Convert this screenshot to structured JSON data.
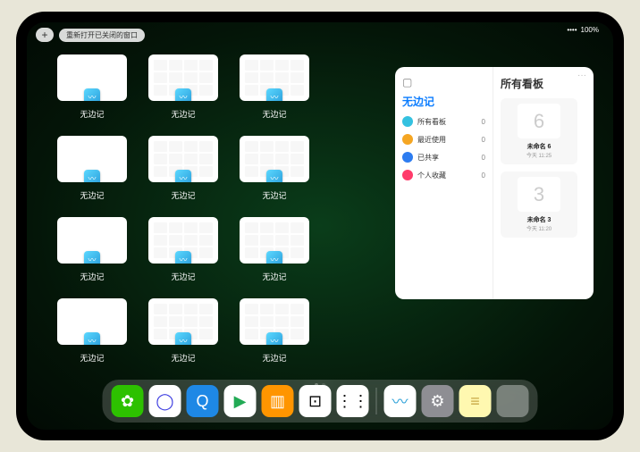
{
  "status": {
    "battery": "100%",
    "signal": "••••"
  },
  "top": {
    "plus": "+",
    "reopen": "重新打开已关闭的窗口"
  },
  "windows": [
    {
      "label": "无边记",
      "style": "blank"
    },
    {
      "label": "无边记",
      "style": "grid"
    },
    {
      "label": "无边记",
      "style": "grid"
    },
    {
      "label": "无边记",
      "style": "blank"
    },
    {
      "label": "无边记",
      "style": "grid"
    },
    {
      "label": "无边记",
      "style": "grid"
    },
    {
      "label": "无边记",
      "style": "blank"
    },
    {
      "label": "无边记",
      "style": "grid"
    },
    {
      "label": "无边记",
      "style": "grid"
    },
    {
      "label": "无边记",
      "style": "blank"
    },
    {
      "label": "无边记",
      "style": "grid"
    },
    {
      "label": "无边记",
      "style": "grid"
    }
  ],
  "panel": {
    "left_title": "无边记",
    "rows": [
      {
        "icon_color": "#34c1e0",
        "icon": "●",
        "label": "所有看板",
        "count": "0"
      },
      {
        "icon_color": "#f5a623",
        "icon": "●",
        "label": "最近使用",
        "count": "0"
      },
      {
        "icon_color": "#2d7cf0",
        "icon": "●",
        "label": "已共享",
        "count": "0"
      },
      {
        "icon_color": "#ff3b6b",
        "icon": "●",
        "label": "个人收藏",
        "count": "0"
      }
    ],
    "right_title": "所有看板",
    "boards": [
      {
        "glyph": "6",
        "name": "未命名 6",
        "sub": "今天 11:25"
      },
      {
        "glyph": "3",
        "name": "未命名 3",
        "sub": "今天 11:20"
      }
    ],
    "more": "···"
  },
  "dock": {
    "items": [
      {
        "name": "wechat",
        "bg": "#2dc100",
        "glyph": "✿"
      },
      {
        "name": "quark",
        "bg": "#ffffff",
        "glyph": "◯",
        "fg": "#3a3ae0"
      },
      {
        "name": "qq-browser",
        "bg": "#1e88e5",
        "glyph": "Q"
      },
      {
        "name": "video",
        "bg": "#ffffff",
        "glyph": "▶",
        "fg": "#22aa55"
      },
      {
        "name": "books",
        "bg": "#ff9500",
        "glyph": "▥"
      },
      {
        "name": "dice",
        "bg": "#ffffff",
        "glyph": "⊡",
        "fg": "#000"
      },
      {
        "name": "node",
        "bg": "#ffffff",
        "glyph": "⋮⋮",
        "fg": "#000"
      }
    ],
    "items2": [
      {
        "name": "freeform",
        "bg": "#ffffff",
        "glyph": "〰",
        "fg": "#2aa0d8"
      },
      {
        "name": "settings",
        "bg": "#8e8e93",
        "glyph": "⚙"
      },
      {
        "name": "notes",
        "bg": "#fff8b0",
        "glyph": "≡",
        "fg": "#c9a947"
      }
    ]
  }
}
